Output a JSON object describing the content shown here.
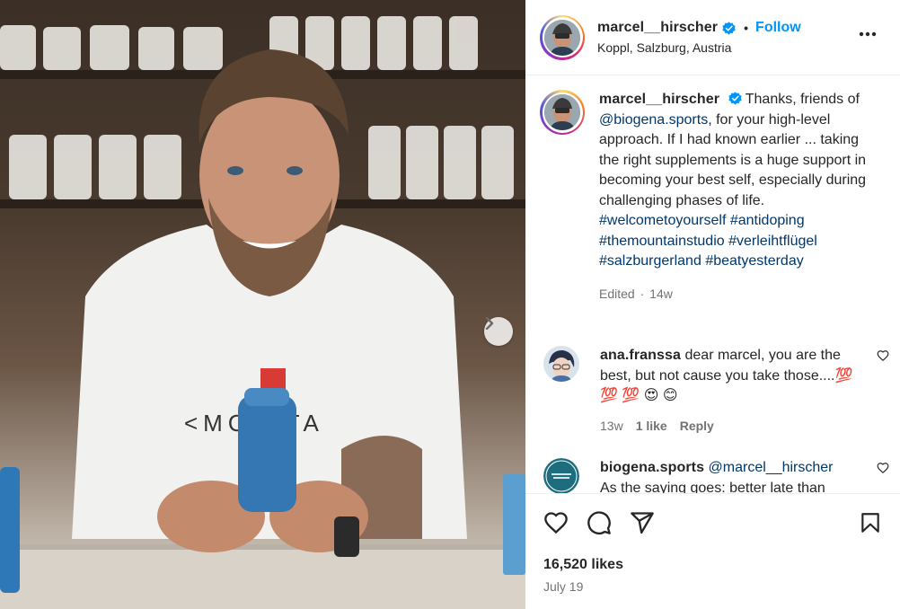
{
  "post": {
    "username": "marcel__hirscher",
    "follow_label": "Follow",
    "separator": "•",
    "location": "Koppl, Salzburg, Austria"
  },
  "caption": {
    "username": "marcel__hirscher",
    "text_1": " Thanks, friends of ",
    "mention": "@biogena.sports",
    "text_2": ", for your high-level approach. If I had known earlier ... taking the right supplements is a huge support in becoming your best self, especially during challenging phases of life.",
    "hashtags": [
      "#welcometoyourself",
      "#antidoping",
      "#themountainstudio",
      "#verleihtflügel",
      "#salzburgerland",
      "#beatyesterday"
    ],
    "edited": "Edited",
    "meta_sep": "·",
    "age": "14w"
  },
  "comments": [
    {
      "username": "ana.franssa",
      "text": " dear marcel, you are the best, but not cause you take those....💯 💯 💯 😍 😊",
      "age": "13w",
      "likes": "1 like",
      "reply": "Reply"
    },
    {
      "username": "biogena.sports",
      "mention": "@marcel__hirscher",
      "text": "As the saying goes: better late than"
    }
  ],
  "stats": {
    "likes": "16,520 likes",
    "date": "July 19"
  },
  "colors": {
    "accent": "#0095f6",
    "verified": "#0095f6",
    "link": "#00376b",
    "meta": "#737373"
  },
  "icons": [
    "verified-badge-icon",
    "more-options-icon",
    "chevron-right-icon",
    "heart-icon",
    "comment-icon",
    "share-icon",
    "bookmark-icon"
  ]
}
